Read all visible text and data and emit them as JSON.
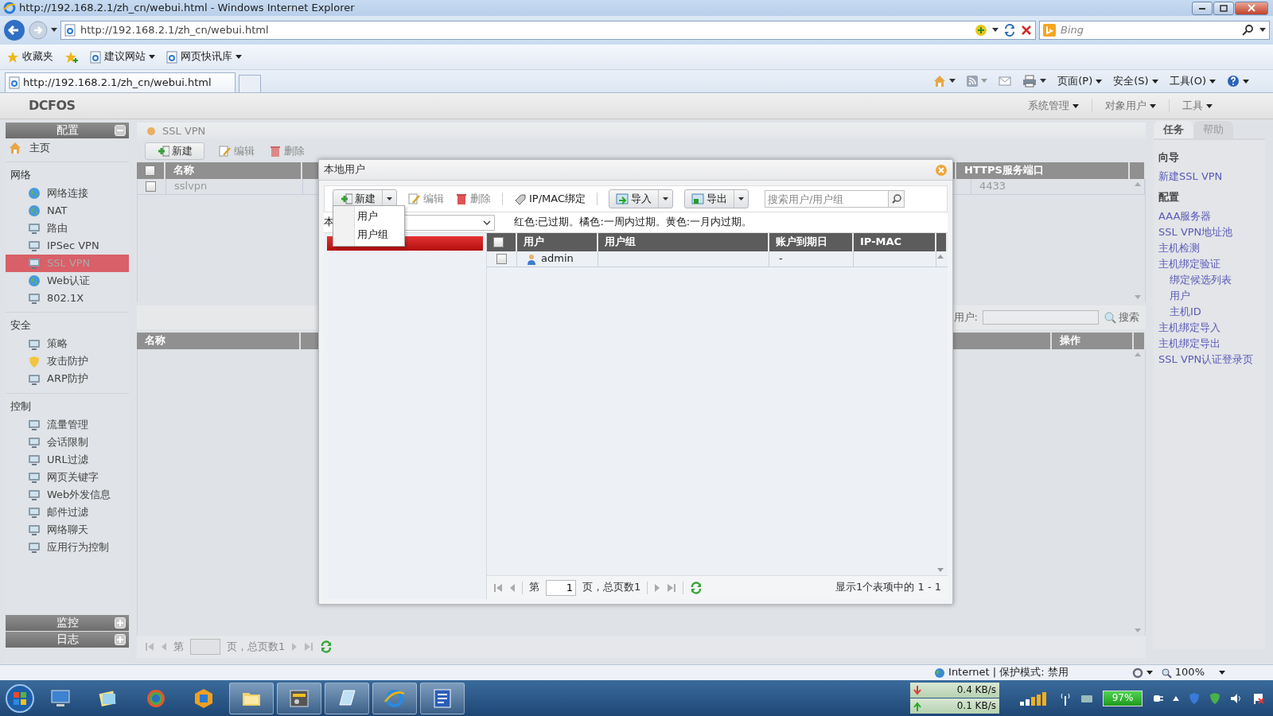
{
  "browser": {
    "title": "http://192.168.2.1/zh_cn/webui.html - Windows Internet Explorer",
    "address": "http://192.168.2.1/zh_cn/webui.html",
    "search_placeholder": "Bing",
    "favorites": [
      {
        "label": "收藏夹",
        "kind": "star"
      },
      {
        "label": "建议网站",
        "kind": "menu"
      },
      {
        "label": "网页快讯库",
        "kind": "menu"
      }
    ],
    "tab": {
      "label": "http://192.168.2.1/zh_cn/webui.html"
    },
    "commands": [
      "页面(P)",
      "安全(S)",
      "工具(O)"
    ]
  },
  "app": {
    "logo": "DCFOS",
    "menus": [
      "系统管理",
      "对象用户",
      "工具"
    ]
  },
  "sidebar": {
    "header": {
      "title": "配置",
      "expanded": true
    },
    "home": "主页",
    "groups": [
      {
        "title": "网络",
        "items": [
          {
            "label": "网络连接",
            "selected": false
          },
          {
            "label": "NAT",
            "selected": false
          },
          {
            "label": "路由",
            "selected": false
          },
          {
            "label": "IPSec VPN",
            "selected": false
          },
          {
            "label": "SSL VPN",
            "selected": true
          },
          {
            "label": "Web认证",
            "selected": false
          },
          {
            "label": "802.1X",
            "selected": false
          }
        ]
      },
      {
        "title": "安全",
        "items": [
          {
            "label": "策略",
            "selected": false
          },
          {
            "label": "攻击防护",
            "selected": false
          },
          {
            "label": "ARP防护",
            "selected": false
          }
        ]
      },
      {
        "title": "控制",
        "items": [
          {
            "label": "流量管理",
            "selected": false
          },
          {
            "label": "会话限制",
            "selected": false
          },
          {
            "label": "URL过滤",
            "selected": false
          },
          {
            "label": "网页关键字",
            "selected": false
          },
          {
            "label": "Web外发信息",
            "selected": false
          },
          {
            "label": "邮件过滤",
            "selected": false
          },
          {
            "label": "网络聊天",
            "selected": false
          },
          {
            "label": "应用行为控制",
            "selected": false
          }
        ]
      }
    ],
    "footer": [
      {
        "title": "监控",
        "expanded": false
      },
      {
        "title": "日志",
        "expanded": false
      }
    ]
  },
  "main": {
    "title": "SSL VPN",
    "toolbar": [
      {
        "label": "新建",
        "disabled": false
      },
      {
        "label": "编辑",
        "disabled": true
      },
      {
        "label": "删除",
        "disabled": true
      }
    ],
    "table": {
      "columns": [
        "名称",
        "HTTPS服务端口"
      ],
      "all_checked": false,
      "rows": [
        {
          "checked": false,
          "name": "sslvpn",
          "port": "4433"
        }
      ]
    },
    "search": {
      "label": "用户:",
      "button": "搜索"
    },
    "lower_table": {
      "columns": [
        "名称",
        "操作"
      ]
    },
    "pager": {
      "prefix": "第",
      "suffix": "页，总页数1"
    }
  },
  "right_panel": {
    "tabs": [
      {
        "label": "任务",
        "selected": true
      },
      {
        "label": "帮助",
        "selected": false
      }
    ],
    "sections": [
      {
        "title": "向导",
        "links": [
          {
            "label": "新建SSL VPN"
          }
        ]
      },
      {
        "title": "配置",
        "links": [
          {
            "label": "AAA服务器"
          },
          {
            "label": "SSL VPN地址池"
          },
          {
            "label": "主机检测"
          },
          {
            "label": "主机绑定验证",
            "children": [
              {
                "label": "绑定候选列表"
              },
              {
                "label": "用户"
              },
              {
                "label": "主机ID"
              }
            ]
          },
          {
            "label": "主机绑定导入"
          },
          {
            "label": "主机绑定导出"
          },
          {
            "label": "SSL VPN认证登录页"
          }
        ]
      }
    ]
  },
  "dialog": {
    "title": "本地用户",
    "toolbar": [
      {
        "kind": "split",
        "label": "新建",
        "disabled": false
      },
      {
        "kind": "button",
        "label": "编辑",
        "disabled": true
      },
      {
        "kind": "button",
        "label": "删除",
        "disabled": true
      },
      {
        "kind": "button",
        "label": "IP/MAC绑定",
        "disabled": false
      },
      {
        "kind": "split",
        "label": "导入",
        "disabled": false
      },
      {
        "kind": "split",
        "label": "导出",
        "disabled": false
      }
    ],
    "search_placeholder": "搜索用户/用户组",
    "menu": {
      "open": true,
      "items": [
        "用户",
        "用户组"
      ]
    },
    "group_label": "本",
    "legend": "红色:已过期。橘色:一周内过期。黄色:一月内过期。",
    "tree_items": [
      {
        "selected": true
      }
    ],
    "table": {
      "columns": [
        "用户",
        "用户组",
        "账户到期日",
        "IP-MAC"
      ],
      "all_checked": false,
      "rows": [
        {
          "checked": false,
          "user": "admin",
          "expiry": "-"
        }
      ]
    },
    "pager": {
      "prefix": "第",
      "page": "1",
      "suffix": "页，总页数1",
      "summary": "显示1个表项中的 1 - 1"
    }
  },
  "status_bar": {
    "zone": "Internet | 保护模式: 禁用",
    "zoom": "100%"
  },
  "taskbar": {
    "apps": [
      {
        "running": false
      },
      {
        "running": false
      },
      {
        "running": false
      },
      {
        "running": false
      },
      {
        "running": true
      },
      {
        "running": true
      },
      {
        "running": true
      },
      {
        "running": true
      },
      {
        "running": true
      }
    ],
    "download": "0.4 KB/s",
    "upload": "0.1 KB/s",
    "battery": "97%"
  }
}
